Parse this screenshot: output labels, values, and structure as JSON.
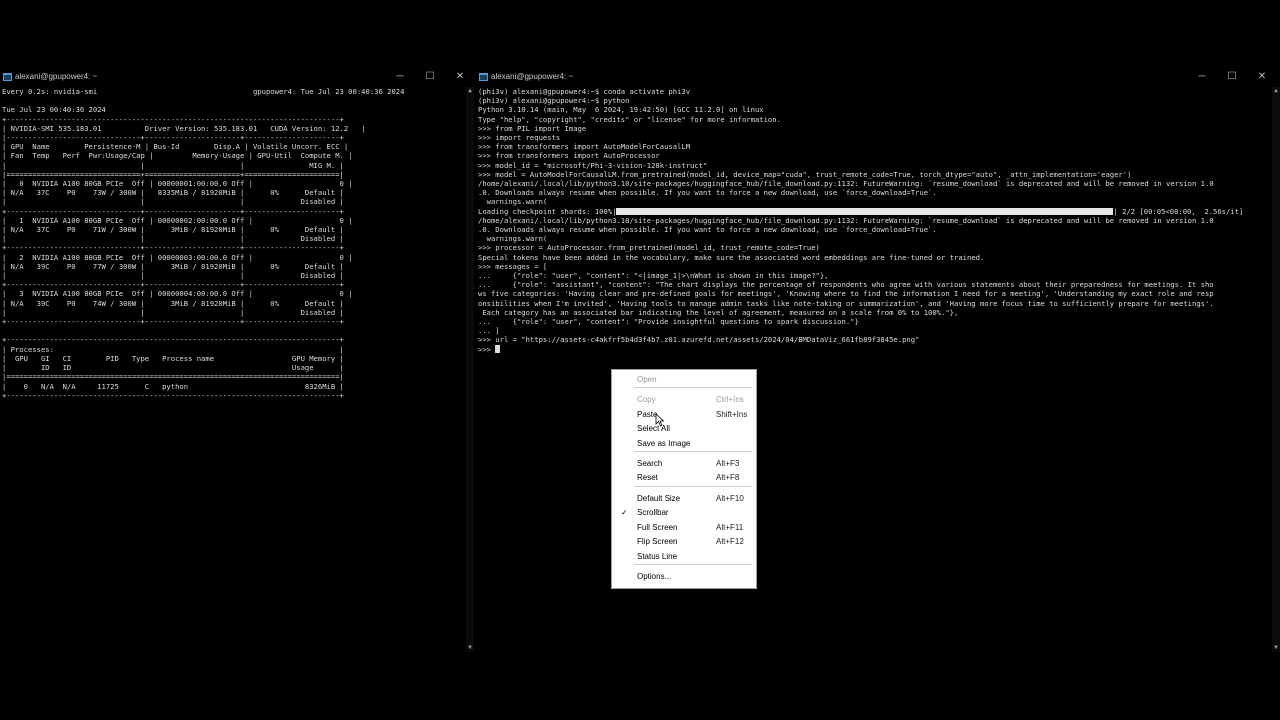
{
  "left_window": {
    "title": "alexani@gpupower4: ~",
    "lines": [
      "Every 0.2s: nvidia-smi                                    gpupower4: Tue Jul 23 00:40:36 2024",
      "",
      "Tue Jul 23 00:40:36 2024",
      "+-----------------------------------------------------------------------------+",
      "| NVIDIA-SMI 535.183.01          Driver Version: 535.183.01   CUDA Version: 12.2   |",
      "|-------------------------------+----------------------+----------------------+",
      "| GPU  Name        Persistence-M | Bus-Id        Disp.A | Volatile Uncorr. ECC |",
      "| Fan  Temp   Perf  Pwr:Usage/Cap |         Memory-Usage | GPU-Util  Compute M. |",
      "|                               |                      |               MIG M. |",
      "|===============================+======================+======================|",
      "|   0  NVIDIA A100 80GB PCIe  Off | 00000001:00:00.0 Off |                    0 |",
      "| N/A   37C    P0    73W / 300W |   8335MiB / 81920MiB |      0%      Default |",
      "|                               |                      |             Disabled |",
      "+-------------------------------+----------------------+----------------------+",
      "|   1  NVIDIA A100 80GB PCIe  Off | 00000002:00:00.0 Off |                    0 |",
      "| N/A   37C    P0    71W / 300W |      3MiB / 81920MiB |      0%      Default |",
      "|                               |                      |             Disabled |",
      "+-------------------------------+----------------------+----------------------+",
      "|   2  NVIDIA A100 80GB PCIe  Off | 00000003:00:00.0 Off |                    0 |",
      "| N/A   39C    P0    77W / 300W |      3MiB / 81920MiB |      0%      Default |",
      "|                               |                      |             Disabled |",
      "+-------------------------------+----------------------+----------------------+",
      "|   3  NVIDIA A100 80GB PCIe  Off | 00000004:00:00.0 Off |                    0 |",
      "| N/A   39C    P0    74W / 300W |      3MiB / 81920MiB |      0%      Default |",
      "|                               |                      |             Disabled |",
      "+-------------------------------+----------------------+----------------------+",
      "",
      "+-----------------------------------------------------------------------------+",
      "| Processes:                                                                  |",
      "|  GPU   GI   CI        PID   Type   Process name                  GPU Memory |",
      "|        ID   ID                                                   Usage      |",
      "|=============================================================================|",
      "|    0   N/A  N/A     11725      C   python                           8326MiB |",
      "+-----------------------------------------------------------------------------+"
    ]
  },
  "right_window": {
    "title": "alexani@gpupower4: ~",
    "lines_before_progress": [
      "(phi3v) alexani@gpupower4:~$ conda activate phi3v",
      "(phi3v) alexani@gpupower4:~$ python",
      "Python 3.10.14 (main, May  6 2024, 19:42:50) [GCC 11.2.0] on linux",
      "Type \"help\", \"copyright\", \"credits\" or \"license\" for more information.",
      ">>> from PIL import Image",
      ">>> import requests",
      ">>> from transformers import AutoModelForCausalLM",
      ">>> from transformers import AutoProcessor",
      ">>> model_id = \"microsoft/Phi-3-vision-128k-instruct\"",
      ">>> model = AutoModelForCausalLM.from_pretrained(model_id, device_map=\"cuda\", trust_remote_code=True, torch_dtype=\"auto\", _attn_implementation='eager')",
      "/home/alexani/.local/lib/python3.10/site-packages/huggingface_hub/file_download.py:1132: FutureWarning: `resume_download` is deprecated and will be removed in version 1.0",
      ".0. Downloads always resume when possible. If you want to force a new download, use `force_download=True`.",
      "  warnings.warn("
    ],
    "progress_prefix": "Loading checkpoint shards: 100%|",
    "progress_suffix": "| 2/2 [00:05<00:00,  2.56s/it]",
    "lines_after_progress": [
      "/home/alexani/.local/lib/python3.10/site-packages/huggingface_hub/file_download.py:1132: FutureWarning: `resume_download` is deprecated and will be removed in version 1.0",
      ".0. Downloads always resume when possible. If you want to force a new download, use `force_download=True`.",
      "  warnings.warn(",
      ">>> processor = AutoProcessor.from_pretrained(model_id, trust_remote_code=True)",
      "Special tokens have been added in the vocabulary, make sure the associated word embeddings are fine-tuned or trained.",
      ">>> messages = [",
      "...     {\"role\": \"user\", \"content\": \"<|image_1|>\\nWhat is shown in this image?\"},",
      "...     {\"role\": \"assistant\", \"content\": \"The chart displays the percentage of respondents who agree with various statements about their preparedness for meetings. It sho",
      "ws five categories: 'Having clear and pre-defined goals for meetings', 'Knowing where to find the information I need for a meeting', 'Understanding my exact role and resp",
      "onsibilities when I'm invited', 'Having tools to manage admin tasks like note-taking or summarization', and 'Having more focus time to sufficiently prepare for meetings'.",
      " Each category has an associated bar indicating the level of agreement, measured on a scale from 0% to 100%.\"},",
      "...     {\"role\": \"user\", \"content\": \"Provide insightful questions to spark discussion.\"}",
      "... ]",
      ">>> url = \"https://assets-c4akfrf5b4d3f4b7.z01.azurefd.net/assets/2024/04/BMDataViz_661fb89f3845e.png\""
    ],
    "prompt_line": ">>> "
  },
  "context_menu": {
    "items": [
      {
        "label": "Open",
        "shortcut": "",
        "disabled": true
      },
      {
        "label": "Copy",
        "shortcut": "Ctrl+Ins",
        "disabled": true
      },
      {
        "label": "Paste",
        "shortcut": "Shift+Ins",
        "disabled": false
      },
      {
        "label": "Select All",
        "shortcut": "",
        "disabled": false
      },
      {
        "label": "Save as Image",
        "shortcut": "",
        "disabled": false
      },
      {
        "label": "Search",
        "shortcut": "Alt+F3",
        "disabled": false
      },
      {
        "label": "Reset",
        "shortcut": "Alt+F8",
        "disabled": false
      },
      {
        "label": "Default Size",
        "shortcut": "Alt+F10",
        "disabled": false
      },
      {
        "label": "Scrollbar",
        "shortcut": "",
        "disabled": false,
        "checked": true
      },
      {
        "label": "Full Screen",
        "shortcut": "Alt+F11",
        "disabled": false
      },
      {
        "label": "Flip Screen",
        "shortcut": "Alt+F12",
        "disabled": false
      },
      {
        "label": "Status Line",
        "shortcut": "",
        "disabled": false
      },
      {
        "label": "Options...",
        "shortcut": "",
        "disabled": false
      }
    ]
  },
  "window_controls": {
    "minimize": "─",
    "maximize": "☐",
    "close": "✕"
  },
  "icons": {
    "app": "terminal-app-icon",
    "check": "✓"
  }
}
